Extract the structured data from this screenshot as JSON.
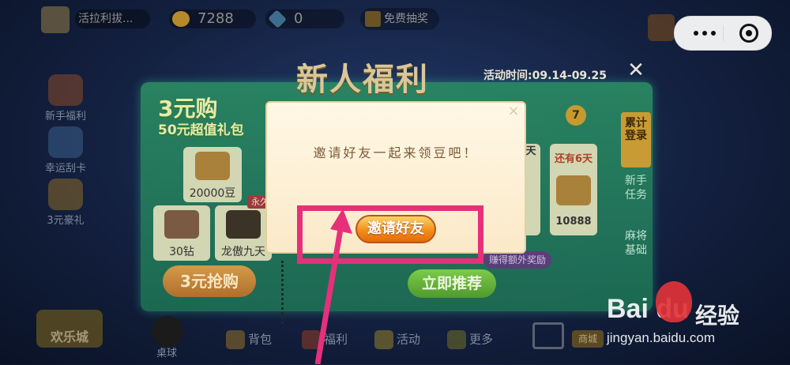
{
  "top_bar": {
    "username": "活拉利拔...",
    "coins": "7288",
    "gems": "0",
    "lottery_label": "免费抽奖"
  },
  "side_menu": [
    {
      "label": "新手福利"
    },
    {
      "label": "幸运刮卡"
    },
    {
      "label": "3元豪礼"
    }
  ],
  "dialog": {
    "title": "新人福利",
    "activity_time": "活动时间:09.14-09.25",
    "close": "✕",
    "promo_title": "3元购",
    "promo_sub": "50元超值礼包",
    "cards": [
      {
        "label": "20000豆"
      },
      {
        "label": "30钻"
      },
      {
        "label": "龙傲九天"
      }
    ],
    "forever_badge": "永久",
    "buy_button": "3元抢购",
    "day6_label": "天",
    "day7_number": "7",
    "day7_top": "还有6天",
    "day7_value": "10888",
    "tabs": {
      "active": "累计登录",
      "task": "新手任务",
      "mahjong": "麻将基础"
    },
    "recommend_button": "立即推荐",
    "extra_reward": "赚得额外奖励"
  },
  "popup": {
    "close": "×",
    "message": "邀请好友一起来领豆吧！",
    "invite_button": "邀请好友"
  },
  "bottom_nav": {
    "happy_city": "欢乐城",
    "billiards": "桌球",
    "bag": "背包",
    "welfare": "福利",
    "activity": "活动",
    "more": "更多",
    "shop_badge": "商城"
  },
  "watermark": {
    "brand": "Bai  du",
    "product": "经验",
    "url": "jingyan.baidu.com"
  },
  "colors": {
    "highlight": "#e6307a",
    "invite_button": "#f08a17",
    "dialog_bg": "#2b8a63"
  }
}
